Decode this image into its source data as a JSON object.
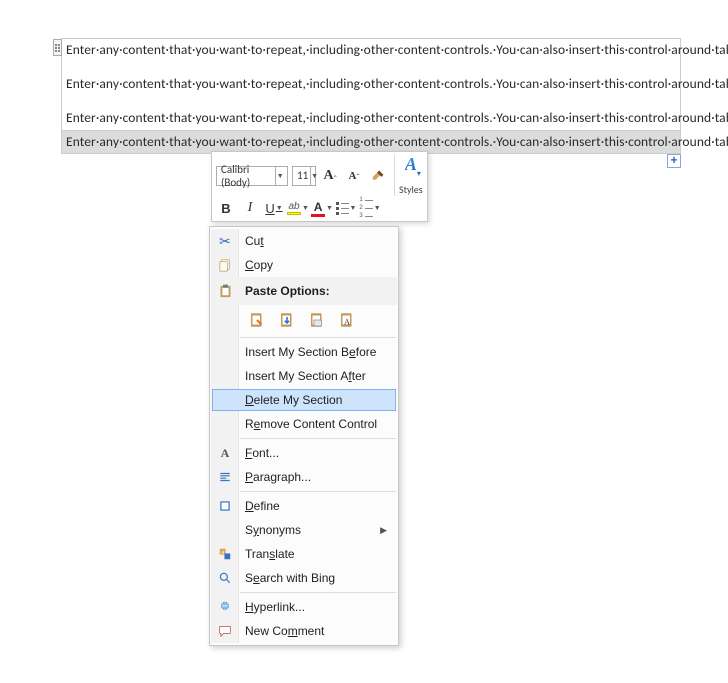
{
  "document": {
    "para1": "Enter·any·content·that·you·want·to·repeat,·including·other·content·controls.·You·can·also·insert·this·control·around·table·rows·in·order·to·repeat·parts·of·a·table.¶",
    "para2": "Enter·any·content·that·you·want·to·repeat,·including·other·content·controls.·You·can·also·insert·this·control·around·table·rows·in·order·to·repeat·parts·of·a·table.¶",
    "para3": "Enter·any·content·that·you·want·to·repeat,·including·other·content·controls.·You·can·also·insert·this·control·around·table·rows·in·order·to·repeat·parts·of·a·table.¶",
    "para4": "Enter·any·content·that·you·want·to·repeat,·including·other·content·controls.·You·can·also·insert·this·control·around·table·rows·in·order·to·repeat·parts·of·a·table.¶",
    "add_label": "+"
  },
  "mini_toolbar": {
    "font_name": "Calibri (Body)",
    "font_size": "11",
    "grow_font": "A",
    "shrink_font": "A",
    "format_painter": "Format Painter",
    "bold": "B",
    "italic": "I",
    "underline": "U",
    "font_color": "A",
    "styles_label": "Styles"
  },
  "context_menu": {
    "cut": "Cut",
    "copy": "Copy",
    "paste_options": "Paste Options:",
    "insert_before": "Insert My Section Before",
    "insert_after": "Insert My Section After",
    "delete_section": "Delete My Section",
    "remove_control": "Remove Content Control",
    "font": "Font...",
    "paragraph": "Paragraph...",
    "define": "Define",
    "synonyms": "Synonyms",
    "translate": "Translate",
    "search_bing": "Search with Bing",
    "hyperlink": "Hyperlink...",
    "new_comment": "New Comment"
  }
}
